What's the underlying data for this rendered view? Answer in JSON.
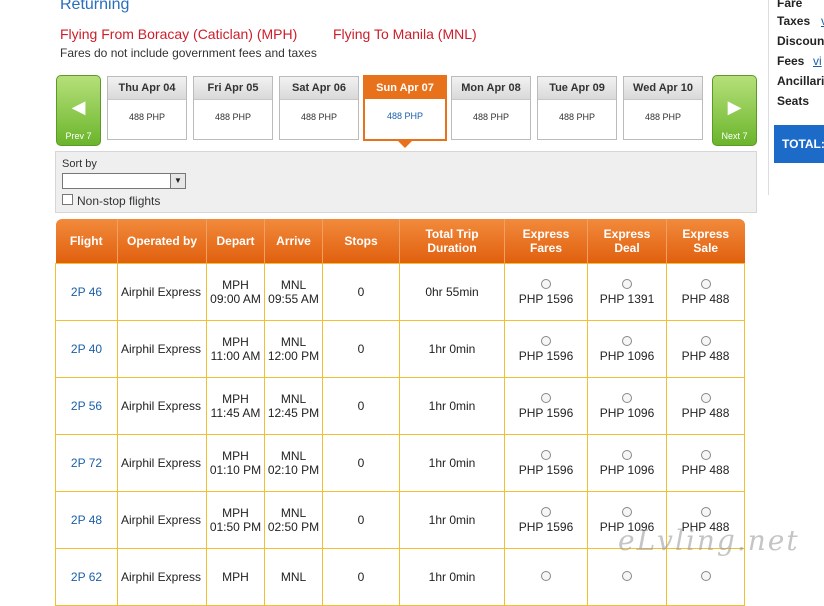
{
  "header": {
    "title": "Returning",
    "from": "Flying From Boracay (Caticlan) (MPH)",
    "to": "Flying To Manila (MNL)",
    "note": "Fares do not include government fees and taxes"
  },
  "summary": {
    "fare_label": "Fare",
    "taxes_label": "Taxes",
    "taxes_link": "vi",
    "discount_label": "Discoun",
    "fees_label": "Fees",
    "fees_link": "vi",
    "ancillaries_label": "Ancillari",
    "seats_label": "Seats",
    "total_label": "TOTAL:"
  },
  "date_nav": {
    "prev_label": "Prev 7",
    "next_label": "Next 7",
    "days": [
      {
        "label": "Thu Apr 04",
        "price": "488 PHP"
      },
      {
        "label": "Fri Apr 05",
        "price": "488 PHP"
      },
      {
        "label": "Sat Apr 06",
        "price": "488 PHP"
      },
      {
        "label": "Sun Apr 07",
        "price": "488 PHP",
        "selected": true
      },
      {
        "label": "Mon Apr 08",
        "price": "488 PHP"
      },
      {
        "label": "Tue Apr 09",
        "price": "488 PHP"
      },
      {
        "label": "Wed Apr 10",
        "price": "488 PHP"
      }
    ]
  },
  "filters": {
    "sort_label": "Sort by",
    "sort_value": "",
    "nonstop_label": "Non-stop flights"
  },
  "table": {
    "headers": {
      "flight": "Flight",
      "operated": "Operated by",
      "depart": "Depart",
      "arrive": "Arrive",
      "stops": "Stops",
      "duration_1": "Total Trip",
      "duration_2": "Duration",
      "fares_1": "Express",
      "fares_2": "Fares",
      "deal_1": "Express",
      "deal_2": "Deal",
      "sale_1": "Express",
      "sale_2": "Sale"
    },
    "rows": [
      {
        "flight": "2P 46",
        "operator": "Airphil Express",
        "dep_code": "MPH",
        "dep_time": "09:00 AM",
        "arr_code": "MNL",
        "arr_time": "09:55 AM",
        "stops": "0",
        "duration": "0hr 55min",
        "fares": "PHP 1596",
        "deal": "PHP 1391",
        "sale": "PHP 488"
      },
      {
        "flight": "2P 40",
        "operator": "Airphil Express",
        "dep_code": "MPH",
        "dep_time": "11:00 AM",
        "arr_code": "MNL",
        "arr_time": "12:00 PM",
        "stops": "0",
        "duration": "1hr 0min",
        "fares": "PHP 1596",
        "deal": "PHP 1096",
        "sale": "PHP 488"
      },
      {
        "flight": "2P 56",
        "operator": "Airphil Express",
        "dep_code": "MPH",
        "dep_time": "11:45 AM",
        "arr_code": "MNL",
        "arr_time": "12:45 PM",
        "stops": "0",
        "duration": "1hr 0min",
        "fares": "PHP 1596",
        "deal": "PHP 1096",
        "sale": "PHP 488"
      },
      {
        "flight": "2P 72",
        "operator": "Airphil Express",
        "dep_code": "MPH",
        "dep_time": "01:10 PM",
        "arr_code": "MNL",
        "arr_time": "02:10 PM",
        "stops": "0",
        "duration": "1hr 0min",
        "fares": "PHP 1596",
        "deal": "PHP 1096",
        "sale": "PHP 488"
      },
      {
        "flight": "2P 48",
        "operator": "Airphil Express",
        "dep_code": "MPH",
        "dep_time": "01:50 PM",
        "arr_code": "MNL",
        "arr_time": "02:50 PM",
        "stops": "0",
        "duration": "1hr 0min",
        "fares": "PHP 1596",
        "deal": "PHP 1096",
        "sale": "PHP 488"
      },
      {
        "flight": "2P 62",
        "operator": "Airphil Express",
        "dep_code": "MPH",
        "dep_time": "",
        "arr_code": "MNL",
        "arr_time": "",
        "stops": "0",
        "duration": "1hr 0min",
        "fares": "",
        "deal": "",
        "sale": ""
      }
    ]
  },
  "watermark": "eLvling.net",
  "colors": {
    "accent": "#e8721c",
    "link": "#1a5fa8",
    "route": "#cc1e2a",
    "nav_green": "#6bb52c",
    "total_blue": "#1d6bc9"
  }
}
